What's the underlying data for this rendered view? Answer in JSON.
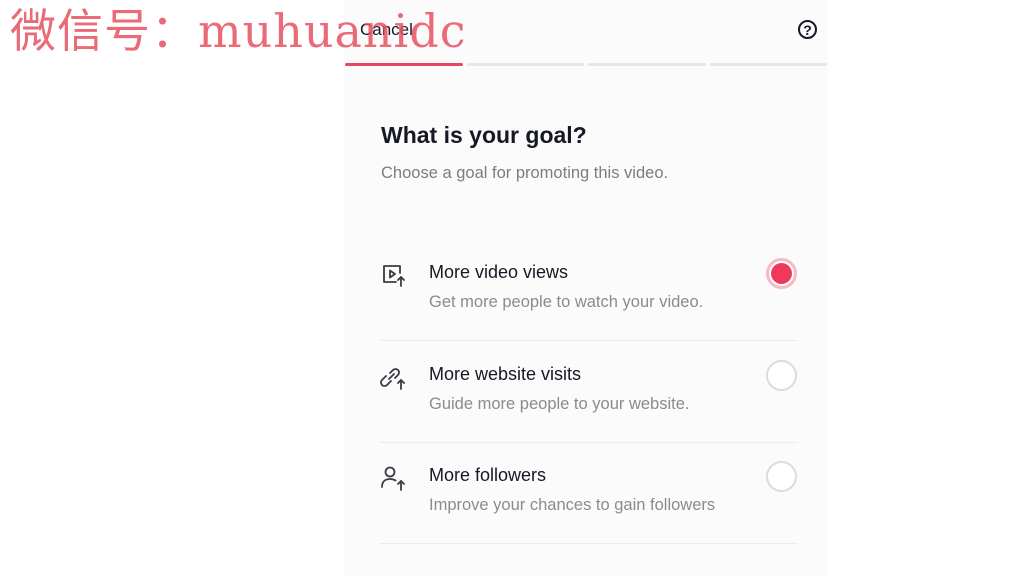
{
  "watermark": "微信号：muhuanidc",
  "header": {
    "cancel_label": "Cancel",
    "help_icon": "?"
  },
  "progress": {
    "total_steps": 4,
    "current_step": 1
  },
  "page": {
    "title": "What is your goal?",
    "subtitle": "Choose a goal for promoting this video."
  },
  "goals": [
    {
      "icon": "video-views-icon",
      "label": "More video views",
      "description": "Get more people to watch your video.",
      "selected": true
    },
    {
      "icon": "website-visits-icon",
      "label": "More website visits",
      "description": "Guide more people to your website.",
      "selected": false
    },
    {
      "icon": "followers-icon",
      "label": "More followers",
      "description": "Improve your chances to gain followers",
      "selected": false
    }
  ],
  "colors": {
    "accent": "#f0385a",
    "progress_active": "#e8455f",
    "text_primary": "#161823",
    "text_secondary": "#8a8b91"
  }
}
